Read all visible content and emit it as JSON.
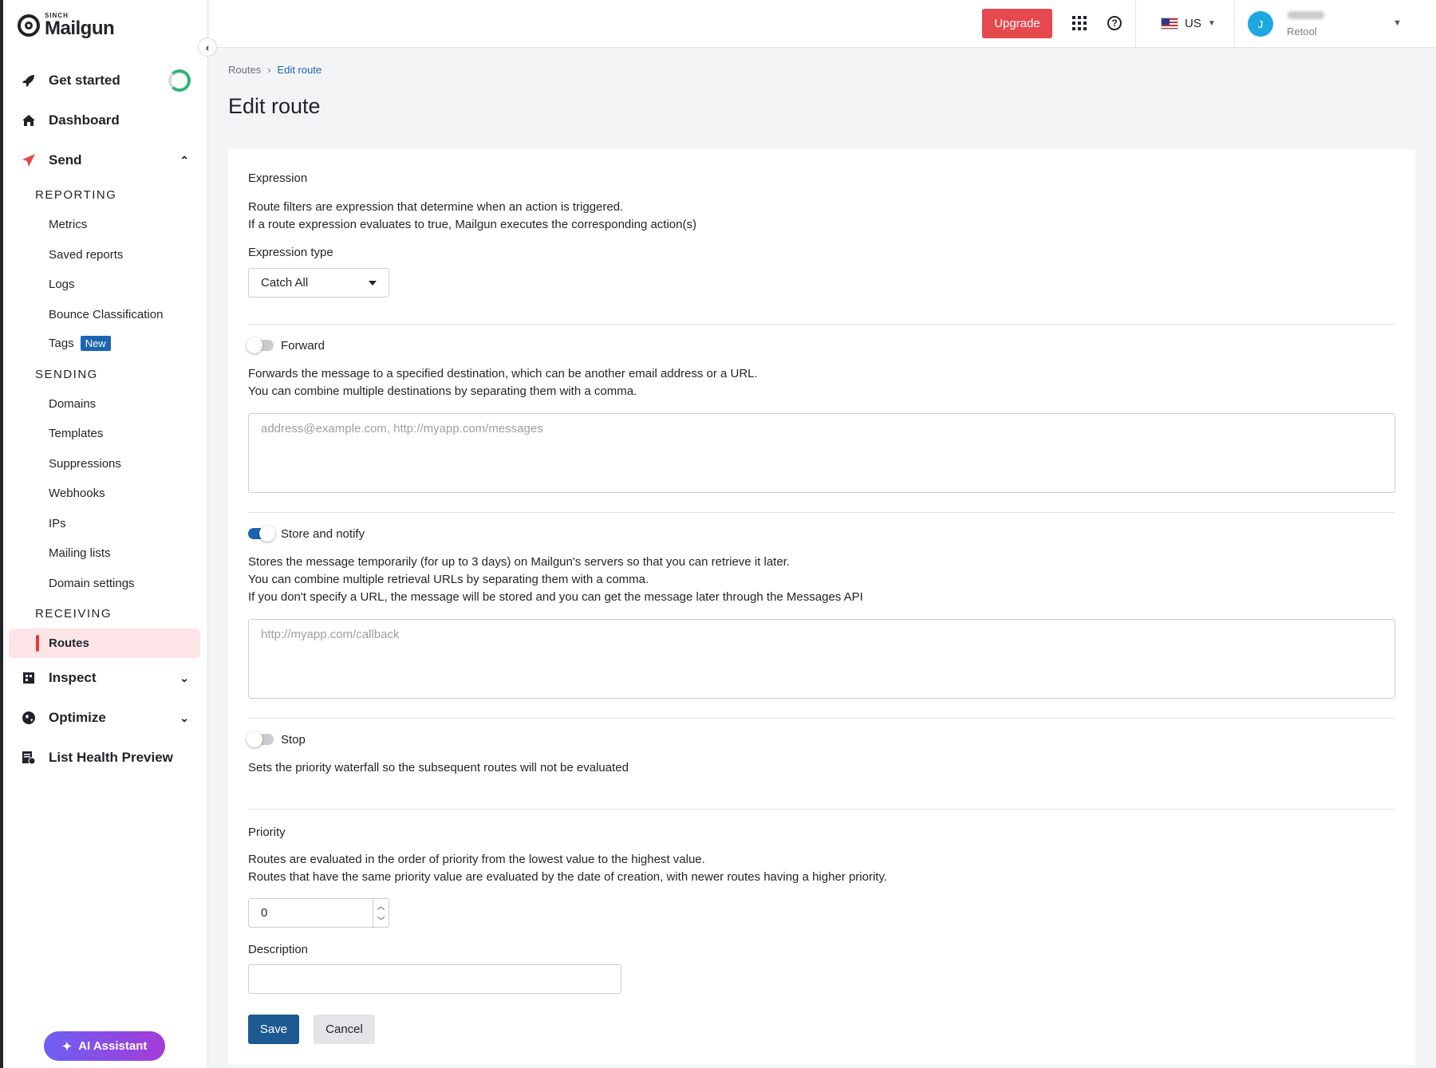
{
  "brand": {
    "sinch": "SINCH",
    "name": "Mailgun"
  },
  "sidebar": {
    "get_started": "Get started",
    "dashboard": "Dashboard",
    "send": "Send",
    "reporting_header": "REPORTING",
    "reporting_items": [
      "Metrics",
      "Saved reports",
      "Logs",
      "Bounce Classification",
      "Tags"
    ],
    "tags_badge": "New",
    "sending_header": "SENDING",
    "sending_items": [
      "Domains",
      "Templates",
      "Suppressions",
      "Webhooks",
      "IPs",
      "Mailing lists",
      "Domain settings"
    ],
    "receiving_header": "RECEIVING",
    "receiving_active": "Routes",
    "inspect": "Inspect",
    "optimize": "Optimize",
    "list_health": "List Health Preview",
    "ai_assistant": "AI Assistant"
  },
  "topbar": {
    "upgrade": "Upgrade",
    "region": "US",
    "avatar_initial": "J",
    "org": "Retool"
  },
  "breadcrumb": {
    "parent": "Routes",
    "current": "Edit route"
  },
  "page_title": "Edit route",
  "form": {
    "expression": {
      "label": "Expression",
      "desc1": "Route filters are expression that determine when an action is triggered.",
      "desc2": "If a route expression evaluates to true, Mailgun executes the corresponding action(s)",
      "type_label": "Expression type",
      "type_value": "Catch All"
    },
    "forward": {
      "label": "Forward",
      "enabled": false,
      "desc1": "Forwards the message to a specified destination, which can be another email address or a URL.",
      "desc2": "You can combine multiple destinations by separating them with a comma.",
      "placeholder": "address@example.com, http://myapp.com/messages"
    },
    "store": {
      "label": "Store and notify",
      "enabled": true,
      "desc1": "Stores the message temporarily (for up to 3 days) on Mailgun's servers so that you can retrieve it later.",
      "desc2": "You can combine multiple retrieval URLs by separating them with a comma.",
      "desc3": "If you don't specify a URL, the message will be stored and you can get the message later through the Messages API",
      "placeholder": "http://myapp.com/callback"
    },
    "stop": {
      "label": "Stop",
      "enabled": false,
      "desc": "Sets the priority waterfall so the subsequent routes will not be evaluated"
    },
    "priority": {
      "label": "Priority",
      "desc1": "Routes are evaluated in the order of priority from the lowest value to the highest value.",
      "desc2": "Routes that have the same priority value are evaluated by the date of creation, with newer routes having a higher priority.",
      "value": "0"
    },
    "description": {
      "label": "Description",
      "value": ""
    },
    "save": "Save",
    "cancel": "Cancel"
  },
  "colors": {
    "accent": "#1b64b0",
    "upgrade": "#e5484d",
    "active_bg": "#fde4e6",
    "active_bar": "#e2363b"
  }
}
